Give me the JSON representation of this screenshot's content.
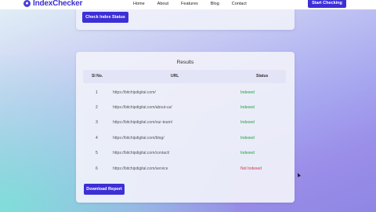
{
  "navbar": {
    "logo_text": "IndexChecker",
    "links": [
      "Home",
      "About",
      "Features",
      "Blog",
      "Contact"
    ],
    "cta_label": "Start Checking"
  },
  "top_card": {
    "check_button_label": "Check Index Status"
  },
  "results": {
    "title": "Results",
    "columns": [
      "Sl No.",
      "URL",
      "Status"
    ],
    "rows": [
      {
        "num": "1",
        "url": "https://bitchipdigital.com/",
        "status": "Indexed",
        "state": "indexed"
      },
      {
        "num": "2",
        "url": "https://bitchipdigital.com/about-us/",
        "status": "Indexed",
        "state": "indexed"
      },
      {
        "num": "3",
        "url": "https://bitchipdigital.com/our-team/",
        "status": "Indexed",
        "state": "indexed"
      },
      {
        "num": "4",
        "url": "https://bitchipdigital.com/blog/",
        "status": "Indexed",
        "state": "indexed"
      },
      {
        "num": "5",
        "url": "https://bitchipdigital.com/contact/",
        "status": "Indexed",
        "state": "indexed"
      },
      {
        "num": "6",
        "url": "https://bitchipdigital.com/service",
        "status": "Not Indexed",
        "state": "notindexed"
      }
    ],
    "download_label": "Download Report"
  },
  "colors": {
    "accent": "#3d2fd6",
    "indexed": "#1d9e3c",
    "not_indexed": "#d6333b"
  }
}
